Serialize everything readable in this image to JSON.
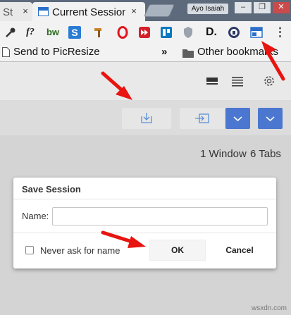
{
  "browser": {
    "tabs": [
      {
        "label": "St"
      },
      {
        "label": "Current Session"
      }
    ],
    "tab_close_glyph": "×",
    "profile_name": "Ayo Isaiah",
    "window_controls": [
      "–",
      "❐",
      "✕"
    ],
    "menu_glyph": "⋮",
    "extensions": [
      {
        "icon": "eyedropper-icon",
        "label": ""
      },
      {
        "icon": "fontface-icon",
        "label": "f?"
      },
      {
        "icon": "builtwith-icon",
        "label": "bw"
      },
      {
        "icon": "s-app-icon",
        "label": "S"
      },
      {
        "icon": "hammer-icon",
        "label": ""
      },
      {
        "icon": "opera-icon",
        "label": ""
      },
      {
        "icon": "fast-forward-icon",
        "label": ""
      },
      {
        "icon": "trello-icon",
        "label": ""
      },
      {
        "icon": "shield-icon",
        "label": ""
      },
      {
        "icon": "d-app-icon",
        "label": "D."
      },
      {
        "icon": "lock-circle-icon",
        "label": ""
      },
      {
        "icon": "session-manager-icon",
        "label": ""
      }
    ],
    "bookmarks": [
      {
        "label": "Send to PicResize"
      },
      {
        "label": "Other bookmarks"
      }
    ],
    "bookmarks_overflow": "»"
  },
  "popup": {
    "stats": {
      "windows": "1 Window",
      "tabs": "6 Tabs"
    }
  },
  "dialog": {
    "title": "Save Session",
    "name_label": "Name:",
    "name_value": "",
    "never_ask_label": "Never ask for name",
    "never_ask_checked": false,
    "ok_label": "OK",
    "cancel_label": "Cancel"
  },
  "watermark": "wsxdn.com",
  "colors": {
    "accent_blue": "#4b77d1",
    "arrow_red": "#e8140f"
  }
}
